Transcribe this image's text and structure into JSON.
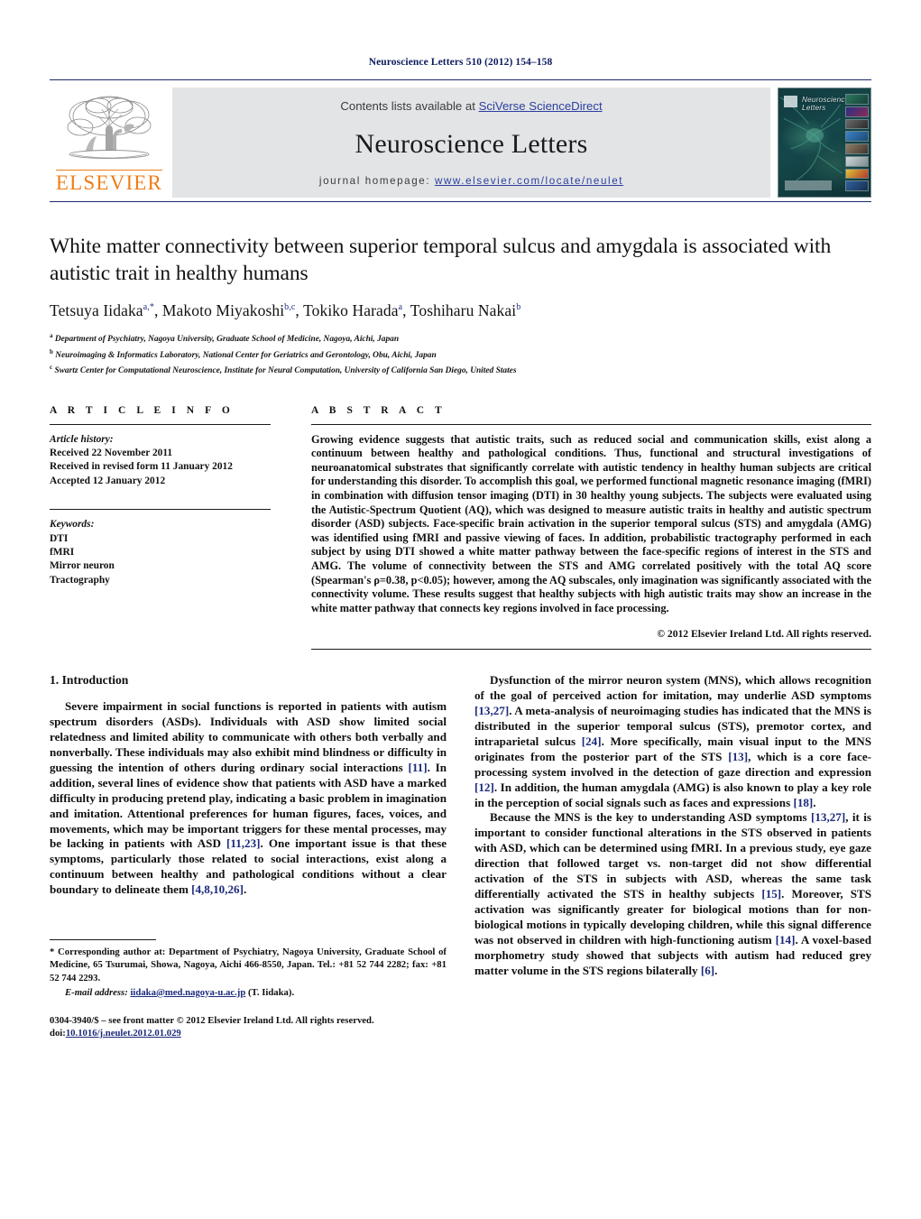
{
  "running_head": "Neuroscience Letters 510 (2012) 154–158",
  "masthead": {
    "contents_prefix": "Contents lists available at ",
    "sciencedirect_link": "SciVerse ScienceDirect",
    "journal_name": "Neuroscience Letters",
    "homepage_prefix": "journal homepage: ",
    "homepage_url": "www.elsevier.com/locate/neulet",
    "publisher_wordmark": "ELSEVIER",
    "cover_title": "Neuroscience Letters",
    "link_color": "#2b3f9e",
    "brand_orange": "#ef7d17",
    "band_gray": "#e3e4e6",
    "rule_navy": "#1b2a6b"
  },
  "title": "White matter connectivity between superior temporal sulcus and amygdala is associated with autistic trait in healthy humans",
  "authors": [
    {
      "name": "Tetsuya Iidaka",
      "sup": "a,*"
    },
    {
      "name": "Makoto Miyakoshi",
      "sup": "b,c"
    },
    {
      "name": "Tokiko Harada",
      "sup": "a"
    },
    {
      "name": "Toshiharu Nakai",
      "sup": "b"
    }
  ],
  "affiliations": [
    {
      "mark": "a",
      "text": "Department of Psychiatry, Nagoya University, Graduate School of Medicine, Nagoya, Aichi, Japan"
    },
    {
      "mark": "b",
      "text": "Neuroimaging & Informatics Laboratory, National Center for Geriatrics and Gerontology, Obu, Aichi, Japan"
    },
    {
      "mark": "c",
      "text": "Swartz Center for Computational Neuroscience, Institute for Neural Computation, University of California San Diego, United States"
    }
  ],
  "article_info": {
    "heading": "A R T I C L E    I N F O",
    "history_label": "Article history:",
    "history": [
      "Received 22 November 2011",
      "Received in revised form 11 January 2012",
      "Accepted 12 January 2012"
    ],
    "keywords_label": "Keywords:",
    "keywords": [
      "DTI",
      "fMRI",
      "Mirror neuron",
      "Tractography"
    ]
  },
  "abstract": {
    "heading": "A B S T R A C T",
    "text": "Growing evidence suggests that autistic traits, such as reduced social and communication skills, exist along a continuum between healthy and pathological conditions. Thus, functional and structural investigations of neuroanatomical substrates that significantly correlate with autistic tendency in healthy human subjects are critical for understanding this disorder. To accomplish this goal, we performed functional magnetic resonance imaging (fMRI) in combination with diffusion tensor imaging (DTI) in 30 healthy young subjects. The subjects were evaluated using the Autistic-Spectrum Quotient (AQ), which was designed to measure autistic traits in healthy and autistic spectrum disorder (ASD) subjects. Face-specific brain activation in the superior temporal sulcus (STS) and amygdala (AMG) was identified using fMRI and passive viewing of faces. In addition, probabilistic tractography performed in each subject by using DTI showed a white matter pathway between the face-specific regions of interest in the STS and AMG. The volume of connectivity between the STS and AMG correlated positively with the total AQ score (Spearman's ρ=0.38, p<0.05); however, among the AQ subscales, only imagination was significantly associated with the connectivity volume. These results suggest that healthy subjects with high autistic traits may show an increase in the white matter pathway that connects key regions involved in face processing.",
    "copyright": "© 2012 Elsevier Ireland Ltd. All rights reserved."
  },
  "introduction": {
    "heading": "1.  Introduction",
    "paragraphs_left": [
      "Severe impairment in social functions is reported in patients with autism spectrum disorders (ASDs). Individuals with ASD show limited social relatedness and limited ability to communicate with others both verbally and nonverbally. These individuals may also exhibit mind blindness or difficulty in guessing the intention of others during ordinary social interactions [11]. In addition, several lines of evidence show that patients with ASD have a marked difficulty in producing pretend play, indicating a basic problem in imagination and imitation. Attentional preferences for human figures, faces, voices, and movements, which may be important triggers for these mental processes, may be lacking in patients with ASD [11,23]. One important issue is that these symptoms, particularly those related to social interactions, exist along a continuum between healthy and pathological conditions without a clear boundary to delineate them [4,8,10,26]."
    ],
    "paragraphs_right": [
      "Dysfunction of the mirror neuron system (MNS), which allows recognition of the goal of perceived action for imitation, may underlie ASD symptoms [13,27]. A meta-analysis of neuroimaging studies has indicated that the MNS is distributed in the superior temporal sulcus (STS), premotor cortex, and intraparietal sulcus [24]. More specifically, main visual input to the MNS originates from the posterior part of the STS [13], which is a core face-processing system involved in the detection of gaze direction and expression [12]. In addition, the human amygdala (AMG) is also known to play a key role in the perception of social signals such as faces and expressions [18].",
      "Because the MNS is the key to understanding ASD symptoms [13,27], it is important to consider functional alterations in the STS observed in patients with ASD, which can be determined using fMRI. In a previous study, eye gaze direction that followed target vs. non-target did not show differential activation of the STS in subjects with ASD, whereas the same task differentially activated the STS in healthy subjects [15]. Moreover, STS activation was significantly greater for biological motions than for non-biological motions in typically developing children, while this signal difference was not observed in children with high-functioning autism [14]. A voxel-based morphometry study showed that subjects with autism had reduced grey matter volume in the STS regions bilaterally [6]."
    ]
  },
  "footnote": {
    "corresponding": "* Corresponding author at: Department of Psychiatry, Nagoya University, Graduate School of Medicine, 65 Tsurumai, Showa, Nagoya, Aichi 466-8550, Japan. Tel.: +81 52 744 2282; fax: +81 52 744 2293.",
    "email_label": "E-mail address:",
    "email": "iidaka@med.nagoya-u.ac.jp",
    "email_owner": "(T. Iidaka).",
    "issn_line": "0304-3940/$ – see front matter © 2012 Elsevier Ireland Ltd. All rights reserved.",
    "doi_label": "doi:",
    "doi_value": "10.1016/j.neulet.2012.01.029"
  }
}
